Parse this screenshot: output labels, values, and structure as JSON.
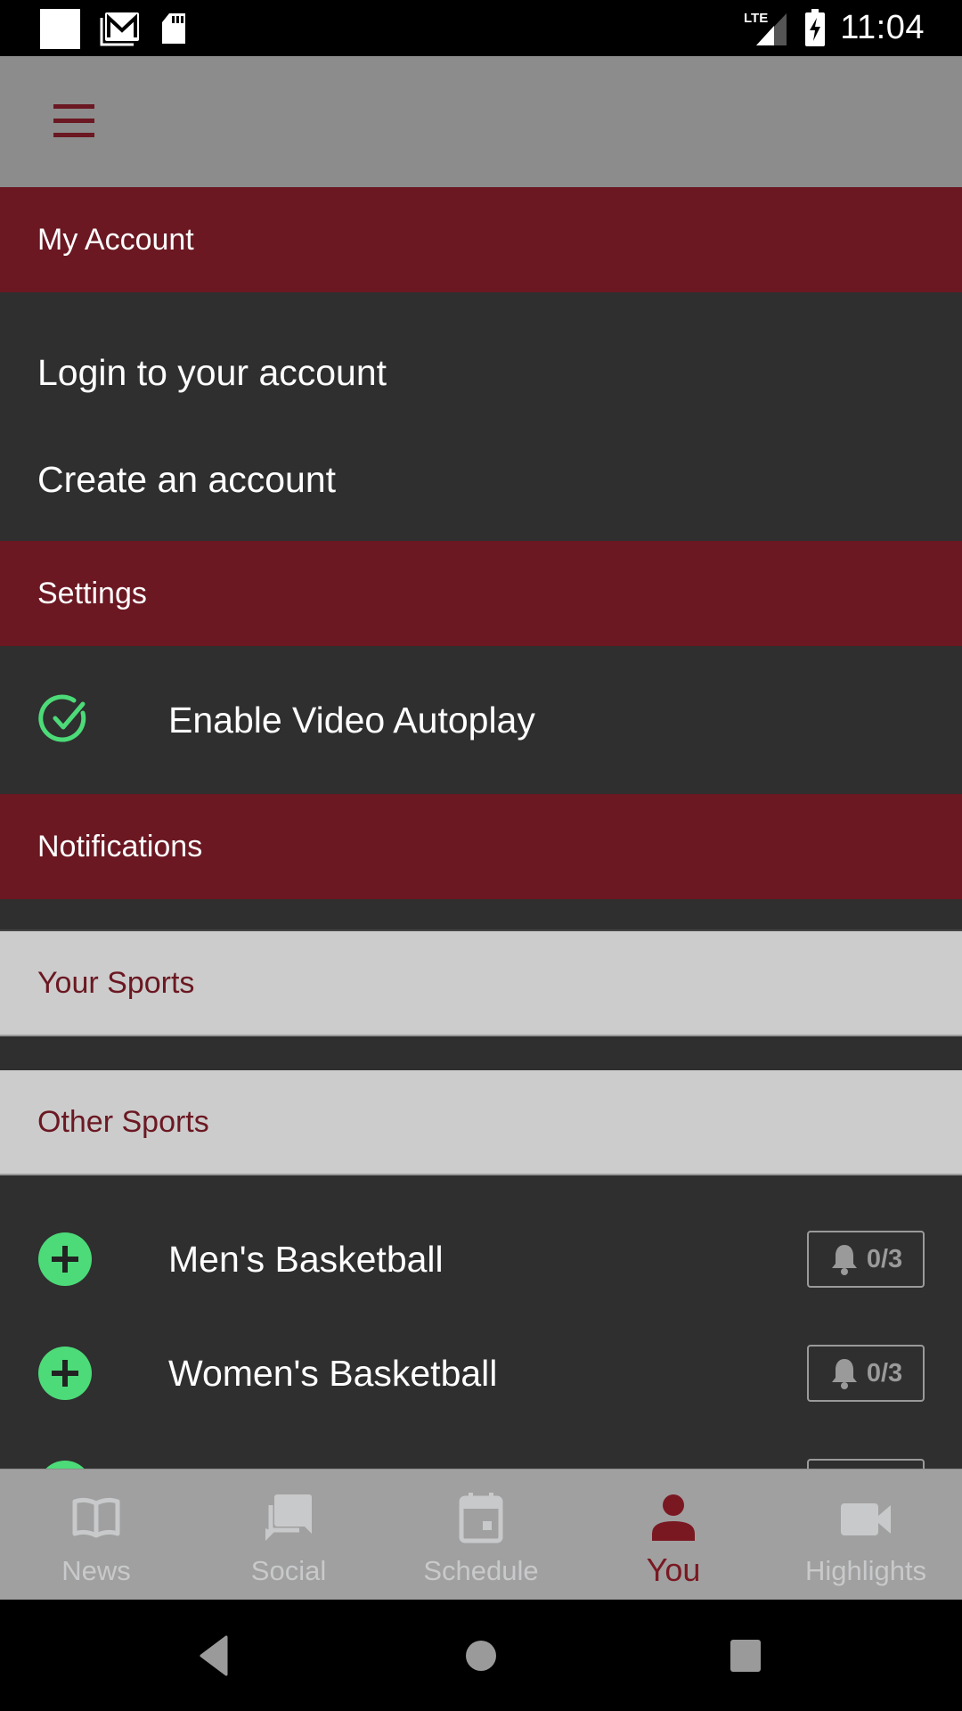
{
  "status_bar": {
    "time": "11:04",
    "network": "LTE",
    "left_icons": [
      "notification-square-icon",
      "gmail-icon",
      "sd-card-icon"
    ],
    "right_icons": [
      "lte-signal-icon",
      "battery-charging-icon"
    ]
  },
  "app_bar": {
    "menu_icon": "hamburger-menu-icon"
  },
  "my_account": {
    "header": "My Account",
    "items": [
      {
        "label": "Login to your account"
      },
      {
        "label": "Create an account"
      }
    ]
  },
  "settings": {
    "header": "Settings",
    "items": [
      {
        "label": "Enable Video Autoplay",
        "enabled": true
      }
    ]
  },
  "notifications": {
    "header": "Notifications",
    "your_sports_label": "Your Sports",
    "other_sports_label": "Other Sports",
    "other_sports": [
      {
        "name": "Men's Basketball",
        "alerts": "0/3"
      },
      {
        "name": "Women's Basketball",
        "alerts": "0/3"
      },
      {
        "name": "",
        "alerts": ""
      }
    ]
  },
  "bottom_nav": {
    "active": "You",
    "items": [
      {
        "label": "News",
        "icon": "book-icon"
      },
      {
        "label": "Social",
        "icon": "chat-icon"
      },
      {
        "label": "Schedule",
        "icon": "calendar-icon"
      },
      {
        "label": "You",
        "icon": "person-icon"
      },
      {
        "label": "Highlights",
        "icon": "video-camera-icon"
      }
    ]
  },
  "colors": {
    "maroon": "#6b1822",
    "dark_bg": "#2f2f2f",
    "green": "#4cdb78",
    "appbar_gray": "#8c8c8c",
    "nav_gray": "#a0a0a0",
    "subheader_gray": "#cccccc"
  }
}
